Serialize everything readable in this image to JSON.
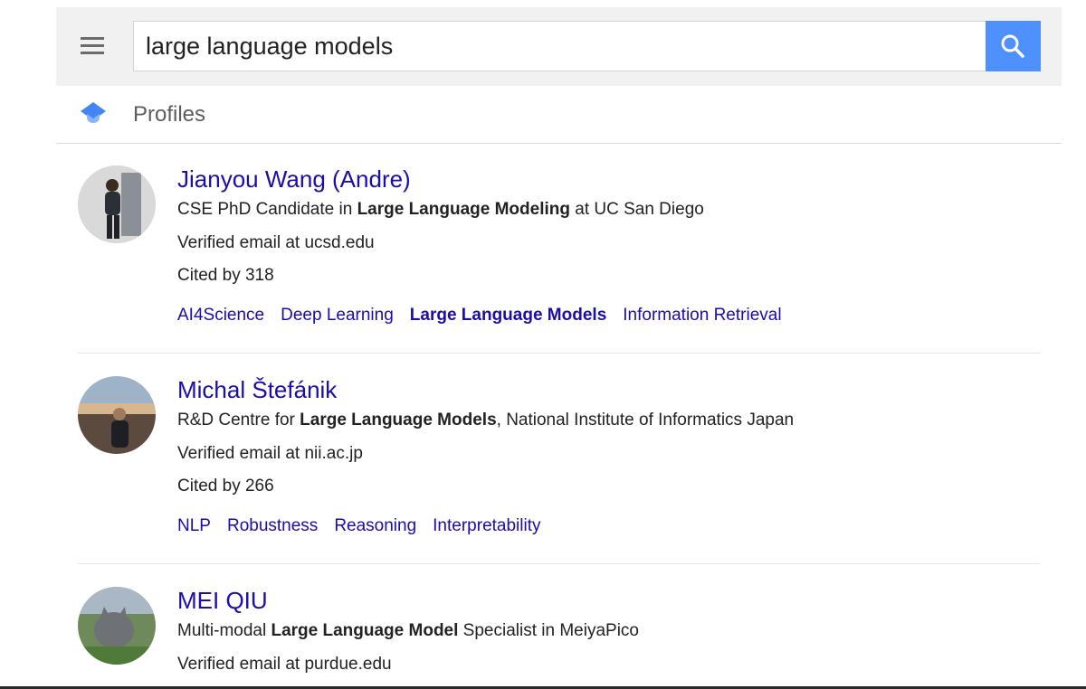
{
  "search": {
    "query": "large language models",
    "menu_icon": "hamburger-menu-icon",
    "search_icon": "magnifier-icon"
  },
  "section": {
    "title": "Profiles",
    "icon": "scholar-cap-icon"
  },
  "profiles": [
    {
      "name": "Jianyou Wang (Andre)",
      "affiliation": {
        "before": "CSE PhD Candidate in ",
        "bold": "Large Language Modeling",
        "after": " at UC San Diego"
      },
      "email": "Verified email at ucsd.edu",
      "cited": "Cited by 318",
      "interests": [
        "AI4Science",
        "Deep Learning",
        "Large Language Models",
        "Information Retrieval"
      ],
      "highlighted_interest": "Large Language Models"
    },
    {
      "name": "Michal Štefánik",
      "affiliation": {
        "before": "R&D Centre for ",
        "bold": "Large Language Models",
        "after": ", National Institute of Informatics Japan"
      },
      "email": "Verified email at nii.ac.jp",
      "cited": "Cited by 266",
      "interests": [
        "NLP",
        "Robustness",
        "Reasoning",
        "Interpretability"
      ]
    },
    {
      "name": "MEI QIU",
      "affiliation": {
        "before": "Multi-modal ",
        "bold": "Large Language Model",
        "after": " Specialist in MeiyaPico"
      },
      "email": "Verified email at purdue.edu"
    }
  ],
  "colors": {
    "link": "#1a0dab",
    "search_button": "#4d90fe",
    "topbar": "#f1f1f1"
  }
}
